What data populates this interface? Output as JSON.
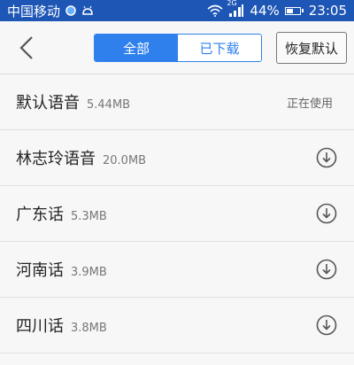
{
  "status_bar": {
    "carrier": "中国移动",
    "network": "2G",
    "battery": "44%",
    "battery_level": 0.44,
    "time": "23:05"
  },
  "toolbar": {
    "tabs": [
      {
        "label": "全部",
        "active": true
      },
      {
        "label": "已下载",
        "active": false
      }
    ],
    "restore_label": "恢复默认"
  },
  "voices": [
    {
      "name": "默认语音",
      "size": "5.44MB",
      "status": "正在使用"
    },
    {
      "name": "林志玲语音",
      "size": "20.0MB",
      "status": ""
    },
    {
      "name": "广东话",
      "size": "5.3MB",
      "status": ""
    },
    {
      "name": "河南话",
      "size": "3.9MB",
      "status": ""
    },
    {
      "name": "四川话",
      "size": "3.8MB",
      "status": ""
    }
  ],
  "colors": {
    "status_bar": "#1e56b5",
    "accent": "#2f80ed"
  }
}
